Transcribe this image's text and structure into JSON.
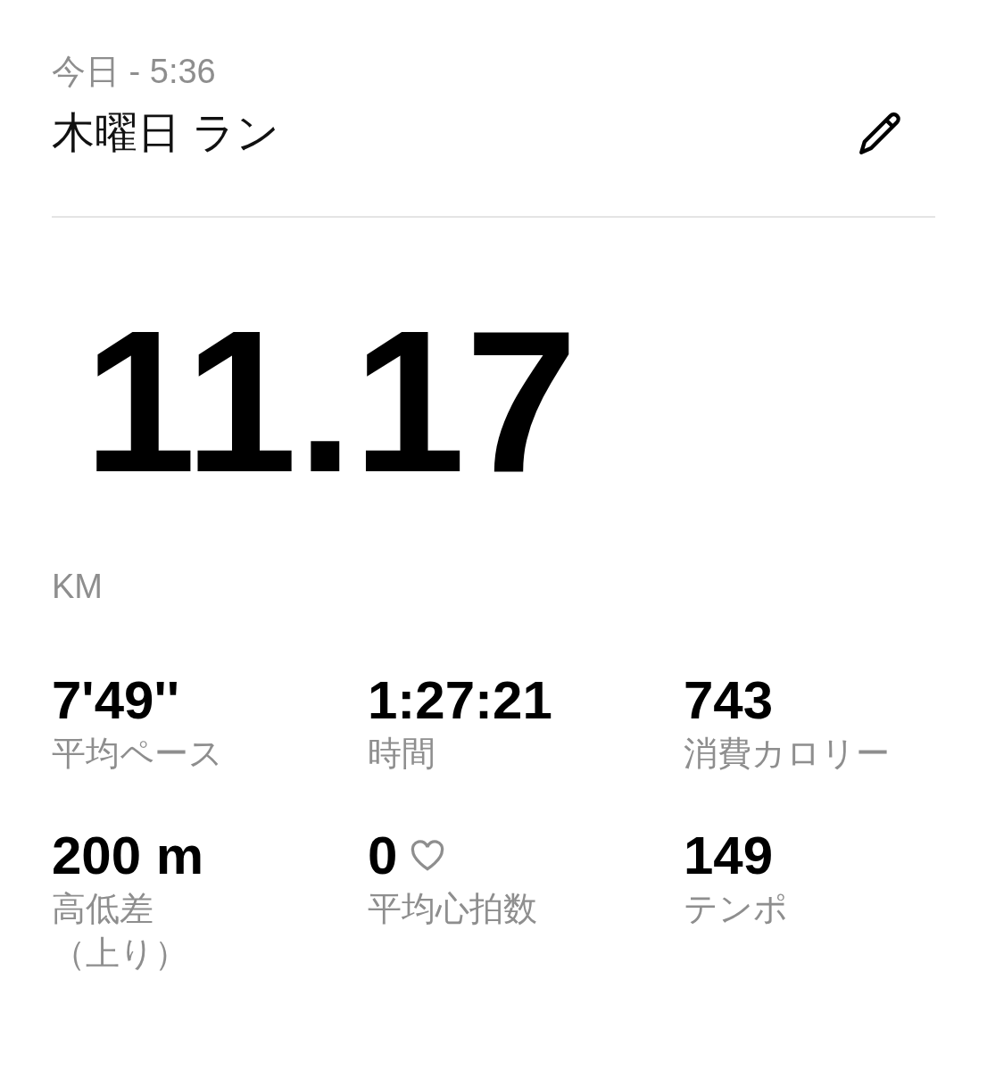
{
  "header": {
    "date": "今日 - 5:36",
    "title": "木曜日 ラン"
  },
  "distance": {
    "value": "11.17",
    "unit": "KM"
  },
  "stats": [
    {
      "kind": "plain",
      "value": "7'49''",
      "label": "平均ペース"
    },
    {
      "kind": "plain",
      "value": "1:27:21",
      "label": "時間"
    },
    {
      "kind": "plain",
      "value": "743",
      "label": "消費カロリー"
    },
    {
      "kind": "plain",
      "value": "200 m",
      "label": "高低差",
      "label_note": "（上り）"
    },
    {
      "kind": "heart",
      "value": "0",
      "label": "平均心拍数"
    },
    {
      "kind": "plain",
      "value": "149",
      "label": "テンポ"
    }
  ]
}
